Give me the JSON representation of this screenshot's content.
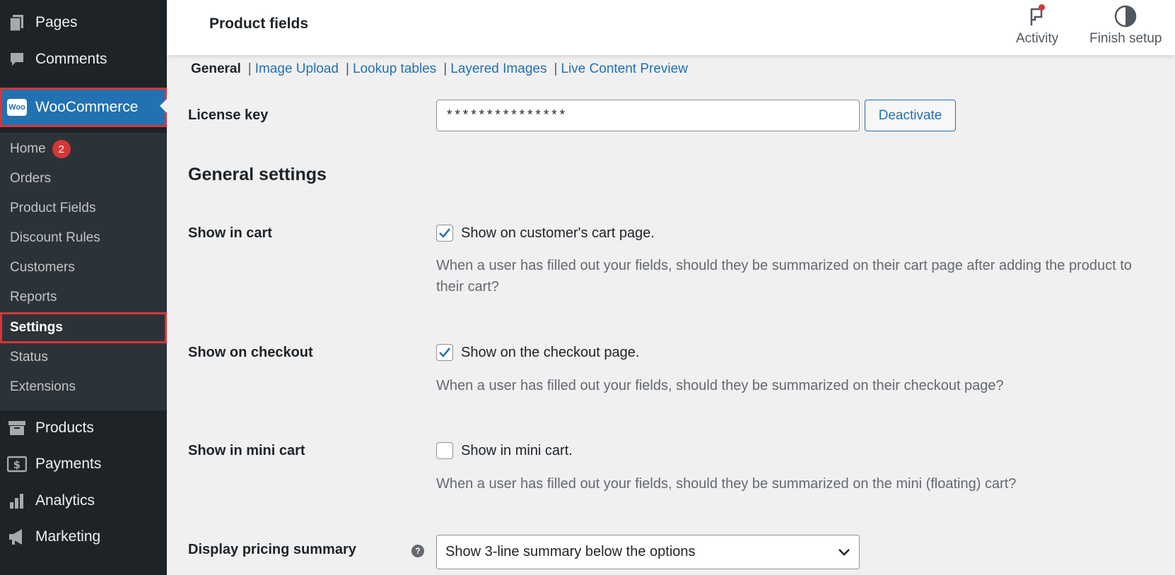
{
  "sidebar": {
    "top_items": [
      {
        "label": "Pages",
        "icon": "pages-icon"
      },
      {
        "label": "Comments",
        "icon": "comments-icon"
      }
    ],
    "woocommerce": {
      "label": "WooCommerce",
      "logo_text": "Woo"
    },
    "submenu": [
      {
        "label": "Home",
        "badge": "2"
      },
      {
        "label": "Orders"
      },
      {
        "label": "Product Fields"
      },
      {
        "label": "Discount Rules"
      },
      {
        "label": "Customers"
      },
      {
        "label": "Reports"
      },
      {
        "label": "Settings"
      },
      {
        "label": "Status"
      },
      {
        "label": "Extensions"
      }
    ],
    "bottom_items": [
      {
        "label": "Products",
        "icon": "archive-icon"
      },
      {
        "label": "Payments",
        "icon": "dollar-icon"
      },
      {
        "label": "Analytics",
        "icon": "bar-chart-icon"
      },
      {
        "label": "Marketing",
        "icon": "megaphone-icon"
      }
    ]
  },
  "header": {
    "title": "Product fields",
    "activity_label": "Activity",
    "finish_setup_label": "Finish setup"
  },
  "tabs": [
    {
      "label": "General"
    },
    {
      "label": "Image Upload"
    },
    {
      "label": "Lookup tables"
    },
    {
      "label": "Layered Images"
    },
    {
      "label": "Live Content Preview"
    }
  ],
  "form": {
    "license": {
      "label": "License key",
      "value": "***************",
      "button": "Deactivate"
    },
    "section_title": "General settings",
    "show_in_cart": {
      "label": "Show in cart",
      "checkbox_label": "Show on customer's cart page.",
      "checked": true,
      "description": "When a user has filled out your fields, should they be summarized on their cart page after adding the product to their cart?"
    },
    "show_on_checkout": {
      "label": "Show on checkout",
      "checkbox_label": "Show on the checkout page.",
      "checked": true,
      "description": "When a user has filled out your fields, should they be summarized on their checkout page?"
    },
    "show_in_mini_cart": {
      "label": "Show in mini cart",
      "checkbox_label": "Show in mini cart.",
      "checked": false,
      "description": "When a user has filled out your fields, should they be summarized on the mini (floating) cart?"
    },
    "pricing_summary": {
      "label": "Display pricing summary",
      "selected": "Show 3-line summary below the options"
    }
  },
  "colors": {
    "accent": "#2271b1",
    "sidebar": "#1d2327",
    "submenu": "#2c3338",
    "highlight": "#d63638"
  }
}
